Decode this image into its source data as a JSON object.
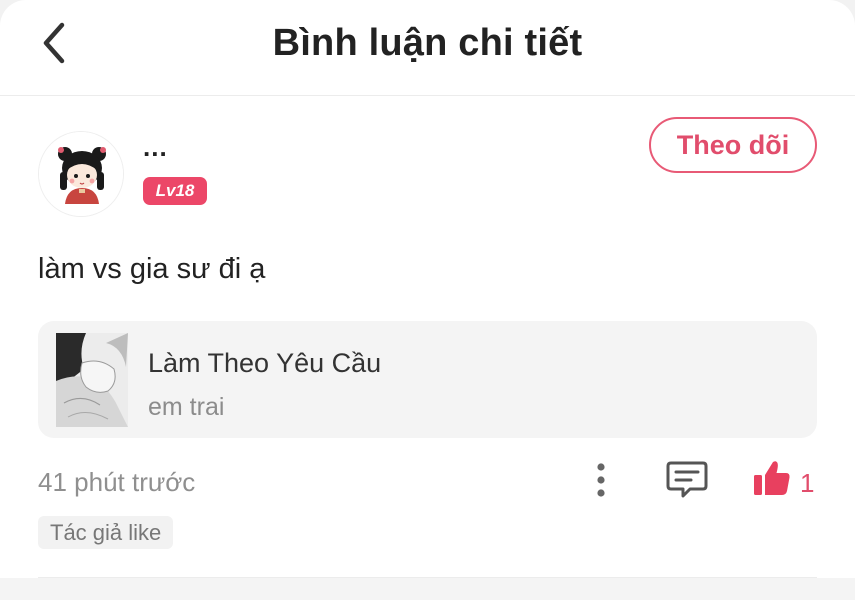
{
  "header": {
    "back_icon": "chevron-left-icon",
    "title": "Bình luận chi tiết"
  },
  "comment": {
    "user": {
      "name": "...",
      "level": "Lv18",
      "avatar_icon": "avatar-girl-icon"
    },
    "follow_label": "Theo dõi",
    "text": "làm vs gia sư đi ạ",
    "story": {
      "title": "Làm Theo Yêu Cầu",
      "subtitle": "em trai"
    },
    "time": "41 phút trước",
    "actions": {
      "more_icon": "more-vertical-icon",
      "reply_icon": "comment-icon",
      "like_icon": "thumbs-up-icon",
      "like_count": "1"
    },
    "tag": "Tác giả like"
  },
  "colors": {
    "accent": "#e14d6c",
    "level_badge": "#ec4768",
    "muted_text": "#8f8f8f",
    "card_bg": "#f4f4f4"
  }
}
